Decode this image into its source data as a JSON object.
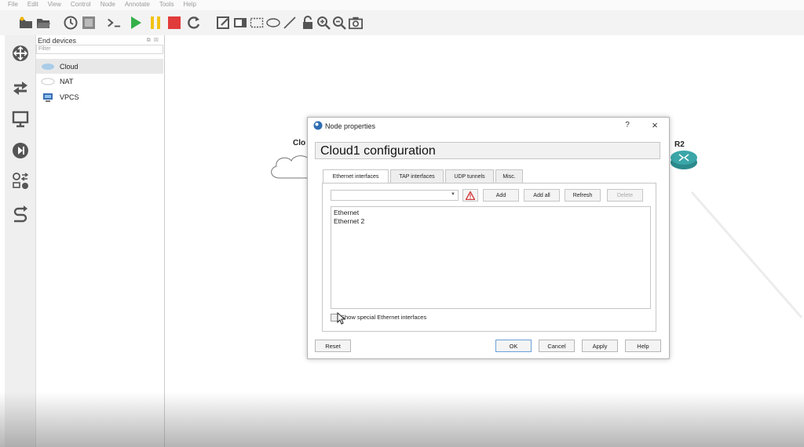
{
  "menu": [
    "File",
    "Edit",
    "View",
    "Control",
    "Node",
    "Annotate",
    "Tools",
    "Help"
  ],
  "toolbar": {
    "icons": [
      "new-project-icon",
      "open-project-icon",
      "snapshot-icon",
      "interface-labels-icon",
      "console-icon",
      "start-all-icon",
      "suspend-all-icon",
      "stop-all-icon",
      "reload-icon",
      "add-note-icon",
      "insert-picture-icon",
      "draw-rectangle-icon",
      "draw-ellipse-icon",
      "draw-line-icon",
      "lock-icon",
      "zoom-in-icon",
      "zoom-out-icon",
      "screenshot-icon"
    ]
  },
  "dock": [
    "routers-icon",
    "switches-icon",
    "end-devices-icon",
    "security-devices-icon",
    "all-devices-icon",
    "add-link-icon"
  ],
  "devices_panel": {
    "title": "End devices",
    "filter_placeholder": "Filter",
    "items": [
      {
        "label": "Cloud",
        "selected": true
      },
      {
        "label": "NAT",
        "selected": false
      },
      {
        "label": "VPCS",
        "selected": false
      }
    ]
  },
  "canvas": {
    "nodes": [
      {
        "label": "Clo"
      },
      {
        "label": "R2"
      }
    ]
  },
  "dialog": {
    "title": "Node properties",
    "help": "?",
    "close": "×",
    "config_title": "Cloud1 configuration",
    "tabs": [
      "Ethernet interfaces",
      "TAP interfaces",
      "UDP tunnels",
      "Misc."
    ],
    "active_tab": "Ethernet interfaces",
    "combo_value": "",
    "buttons_top": {
      "add": "Add",
      "add_all": "Add all",
      "refresh": "Refresh",
      "delete": "Delete"
    },
    "interfaces": [
      "Ethernet",
      "Ethernet 2"
    ],
    "show_special_label": "Show special Ethernet interfaces",
    "show_special_checked": false,
    "footer": {
      "reset": "Reset",
      "ok": "OK",
      "cancel": "Cancel",
      "apply": "Apply",
      "help": "Help"
    }
  },
  "colors": {
    "stop": "#e23b3b",
    "start": "#35b04a",
    "suspend": "#f2c314",
    "router": "#2b8a8c",
    "warning": "#d23c3c"
  }
}
